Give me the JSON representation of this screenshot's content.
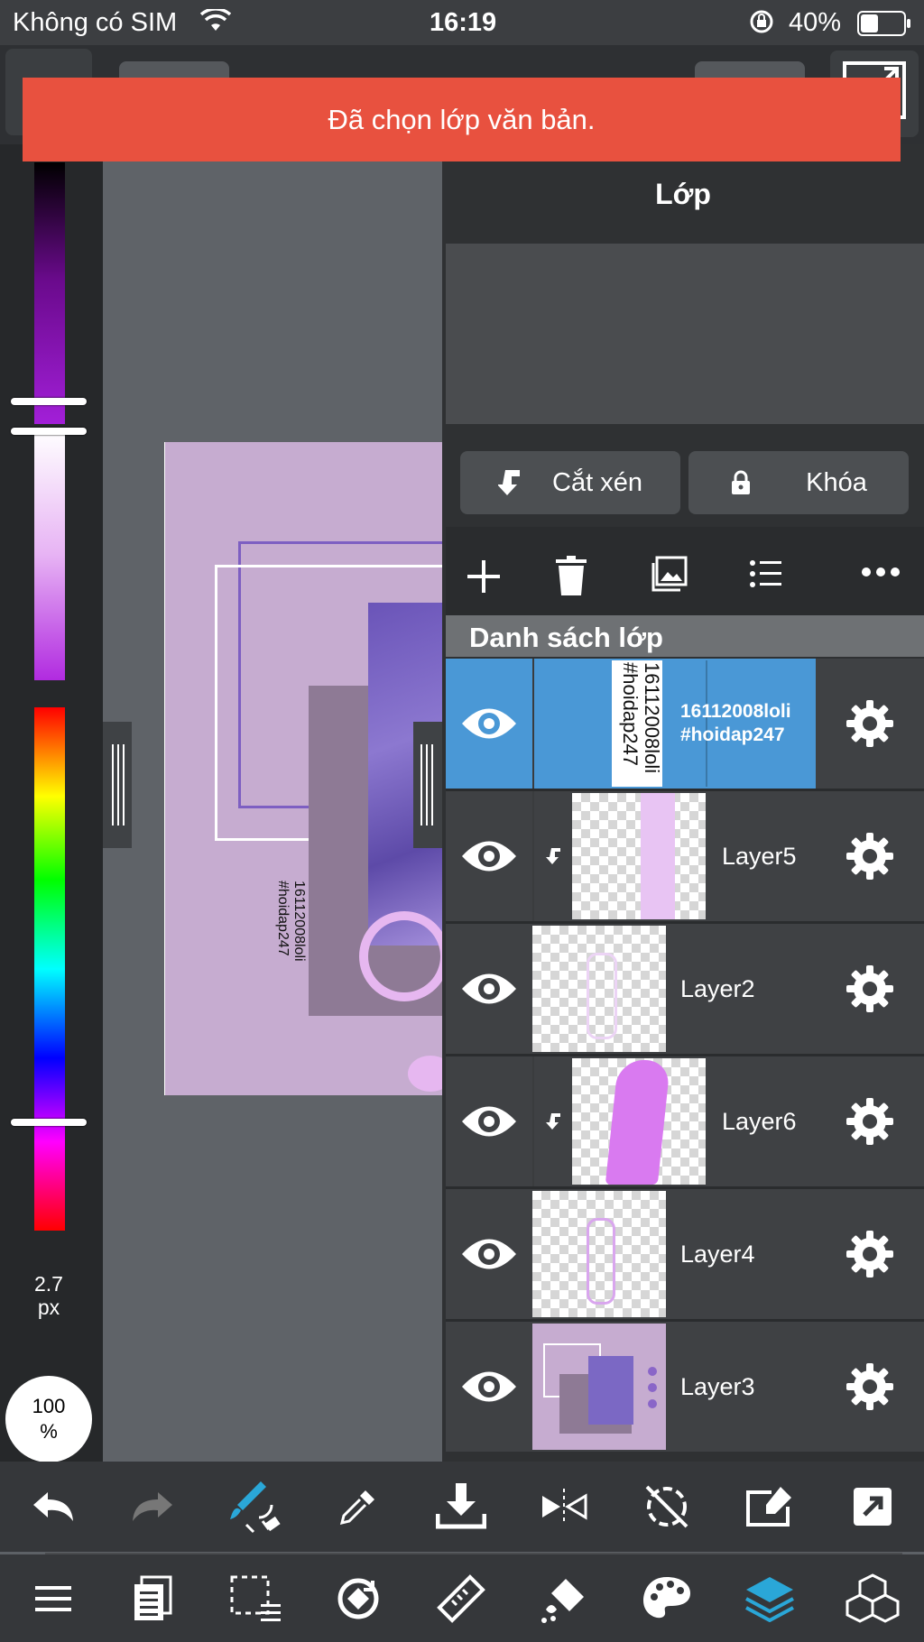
{
  "status": {
    "carrier": "Không có SIM",
    "time": "16:19",
    "battery": "40%"
  },
  "toast": "Đã chọn lớp văn bản.",
  "brush": {
    "size_value": "2.7",
    "size_unit": "px",
    "opacity": "100",
    "opacity_unit": "%"
  },
  "canvas_text": {
    "line1": "16112008loli",
    "line2": "#hoidap247"
  },
  "layer_panel": {
    "title": "Lớp",
    "clip_button": "Cắt xén",
    "lock_button": "Khóa",
    "list_title": "Danh sách lớp",
    "layers": [
      {
        "name_line1": "16112008loli",
        "name_line2": "#hoidap247",
        "selected": true,
        "clipped": false
      },
      {
        "name": "Layer5",
        "clipped": true
      },
      {
        "name": "Layer2",
        "clipped": false
      },
      {
        "name": "Layer6",
        "clipped": true
      },
      {
        "name": "Layer4",
        "clipped": false
      },
      {
        "name": "Layer3",
        "clipped": false
      }
    ]
  },
  "colors": {
    "toast": "#e8513f",
    "selected_layer": "#4a98d6",
    "panel": "#2f3133",
    "accent_tool": "#2aa7d8"
  },
  "toolbar1": [
    "undo-icon",
    "redo-icon",
    "brush-transform-icon",
    "eyedropper-icon",
    "import-icon",
    "flip-icon",
    "rotate-reset-icon",
    "edit-frame-icon",
    "share-icon"
  ],
  "toolbar2": [
    "menu-icon",
    "pages-icon",
    "selection-icon",
    "transform-icon",
    "ruler-icon",
    "fill-icon",
    "palette-icon",
    "layers-icon",
    "3d-cube-icon"
  ]
}
